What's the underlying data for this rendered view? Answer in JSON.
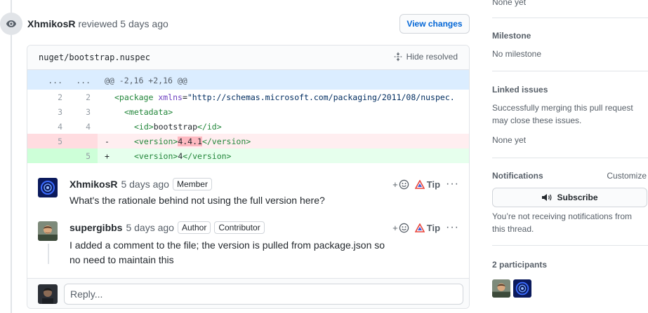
{
  "review": {
    "author": "XhmikosR",
    "action": "reviewed",
    "time": "5 days ago",
    "view_changes_label": "View changes"
  },
  "file": {
    "name": "nuget/bootstrap.nuspec",
    "hide_resolved_label": "Hide resolved"
  },
  "diff": {
    "hunk_old": "...",
    "hunk_new": "...",
    "hunk_header": "@@ -2,16 +2,16 @@",
    "lines": [
      {
        "old": "2",
        "new": "2",
        "marker": "",
        "tag_open": "<package ",
        "attr": "xmlns",
        "eq": "=",
        "str": "\"http://schemas.microsoft.com/packaging/2011/08/nuspec.",
        "rest": ""
      },
      {
        "old": "3",
        "new": "3",
        "marker": "",
        "indent": "  ",
        "tag": "<metadata>"
      },
      {
        "old": "4",
        "new": "4",
        "marker": "",
        "indent": "    ",
        "tag_a": "<id>",
        "text": "bootstrap",
        "tag_b": "</id>"
      },
      {
        "old": "5",
        "new": "",
        "marker": "-",
        "indent": "    ",
        "tag_a": "<version>",
        "text_hl": "4.4.1",
        "tag_b": "</version>"
      },
      {
        "old": "",
        "new": "5",
        "marker": "+",
        "indent": "    ",
        "tag_a": "<version>",
        "text": "4",
        "tag_b": "</version>"
      }
    ]
  },
  "comments": [
    {
      "author": "XhmikosR",
      "time": "5 days ago",
      "labels": [
        "Member"
      ],
      "body": "What's the rationale behind not using the full version here?",
      "reaction_label": "+",
      "tip_label": "Tip",
      "more_label": "···"
    },
    {
      "author": "supergibbs",
      "time": "5 days ago",
      "labels": [
        "Author",
        "Contributor"
      ],
      "body": "I added a comment to the file; the version is pulled from package.json so no need to maintain this",
      "reaction_label": "+",
      "tip_label": "Tip",
      "more_label": "···"
    }
  ],
  "reply": {
    "placeholder": "Reply..."
  },
  "sidebar": {
    "top_value": "None yet",
    "milestone": {
      "title": "Milestone",
      "value": "No milestone"
    },
    "linked_issues": {
      "title": "Linked issues",
      "description": "Successfully merging this pull request may close these issues.",
      "value": "None yet"
    },
    "notifications": {
      "title": "Notifications",
      "customize_label": "Customize",
      "subscribe_label": "Subscribe",
      "status": "You’re not receiving notifications from this thread."
    },
    "participants": {
      "title": "2 participants"
    }
  },
  "colors": {
    "link": "#0366d6",
    "deleted_bg": "#ffeef0",
    "added_bg": "#e6ffed",
    "hunk_bg": "#dbedff"
  }
}
